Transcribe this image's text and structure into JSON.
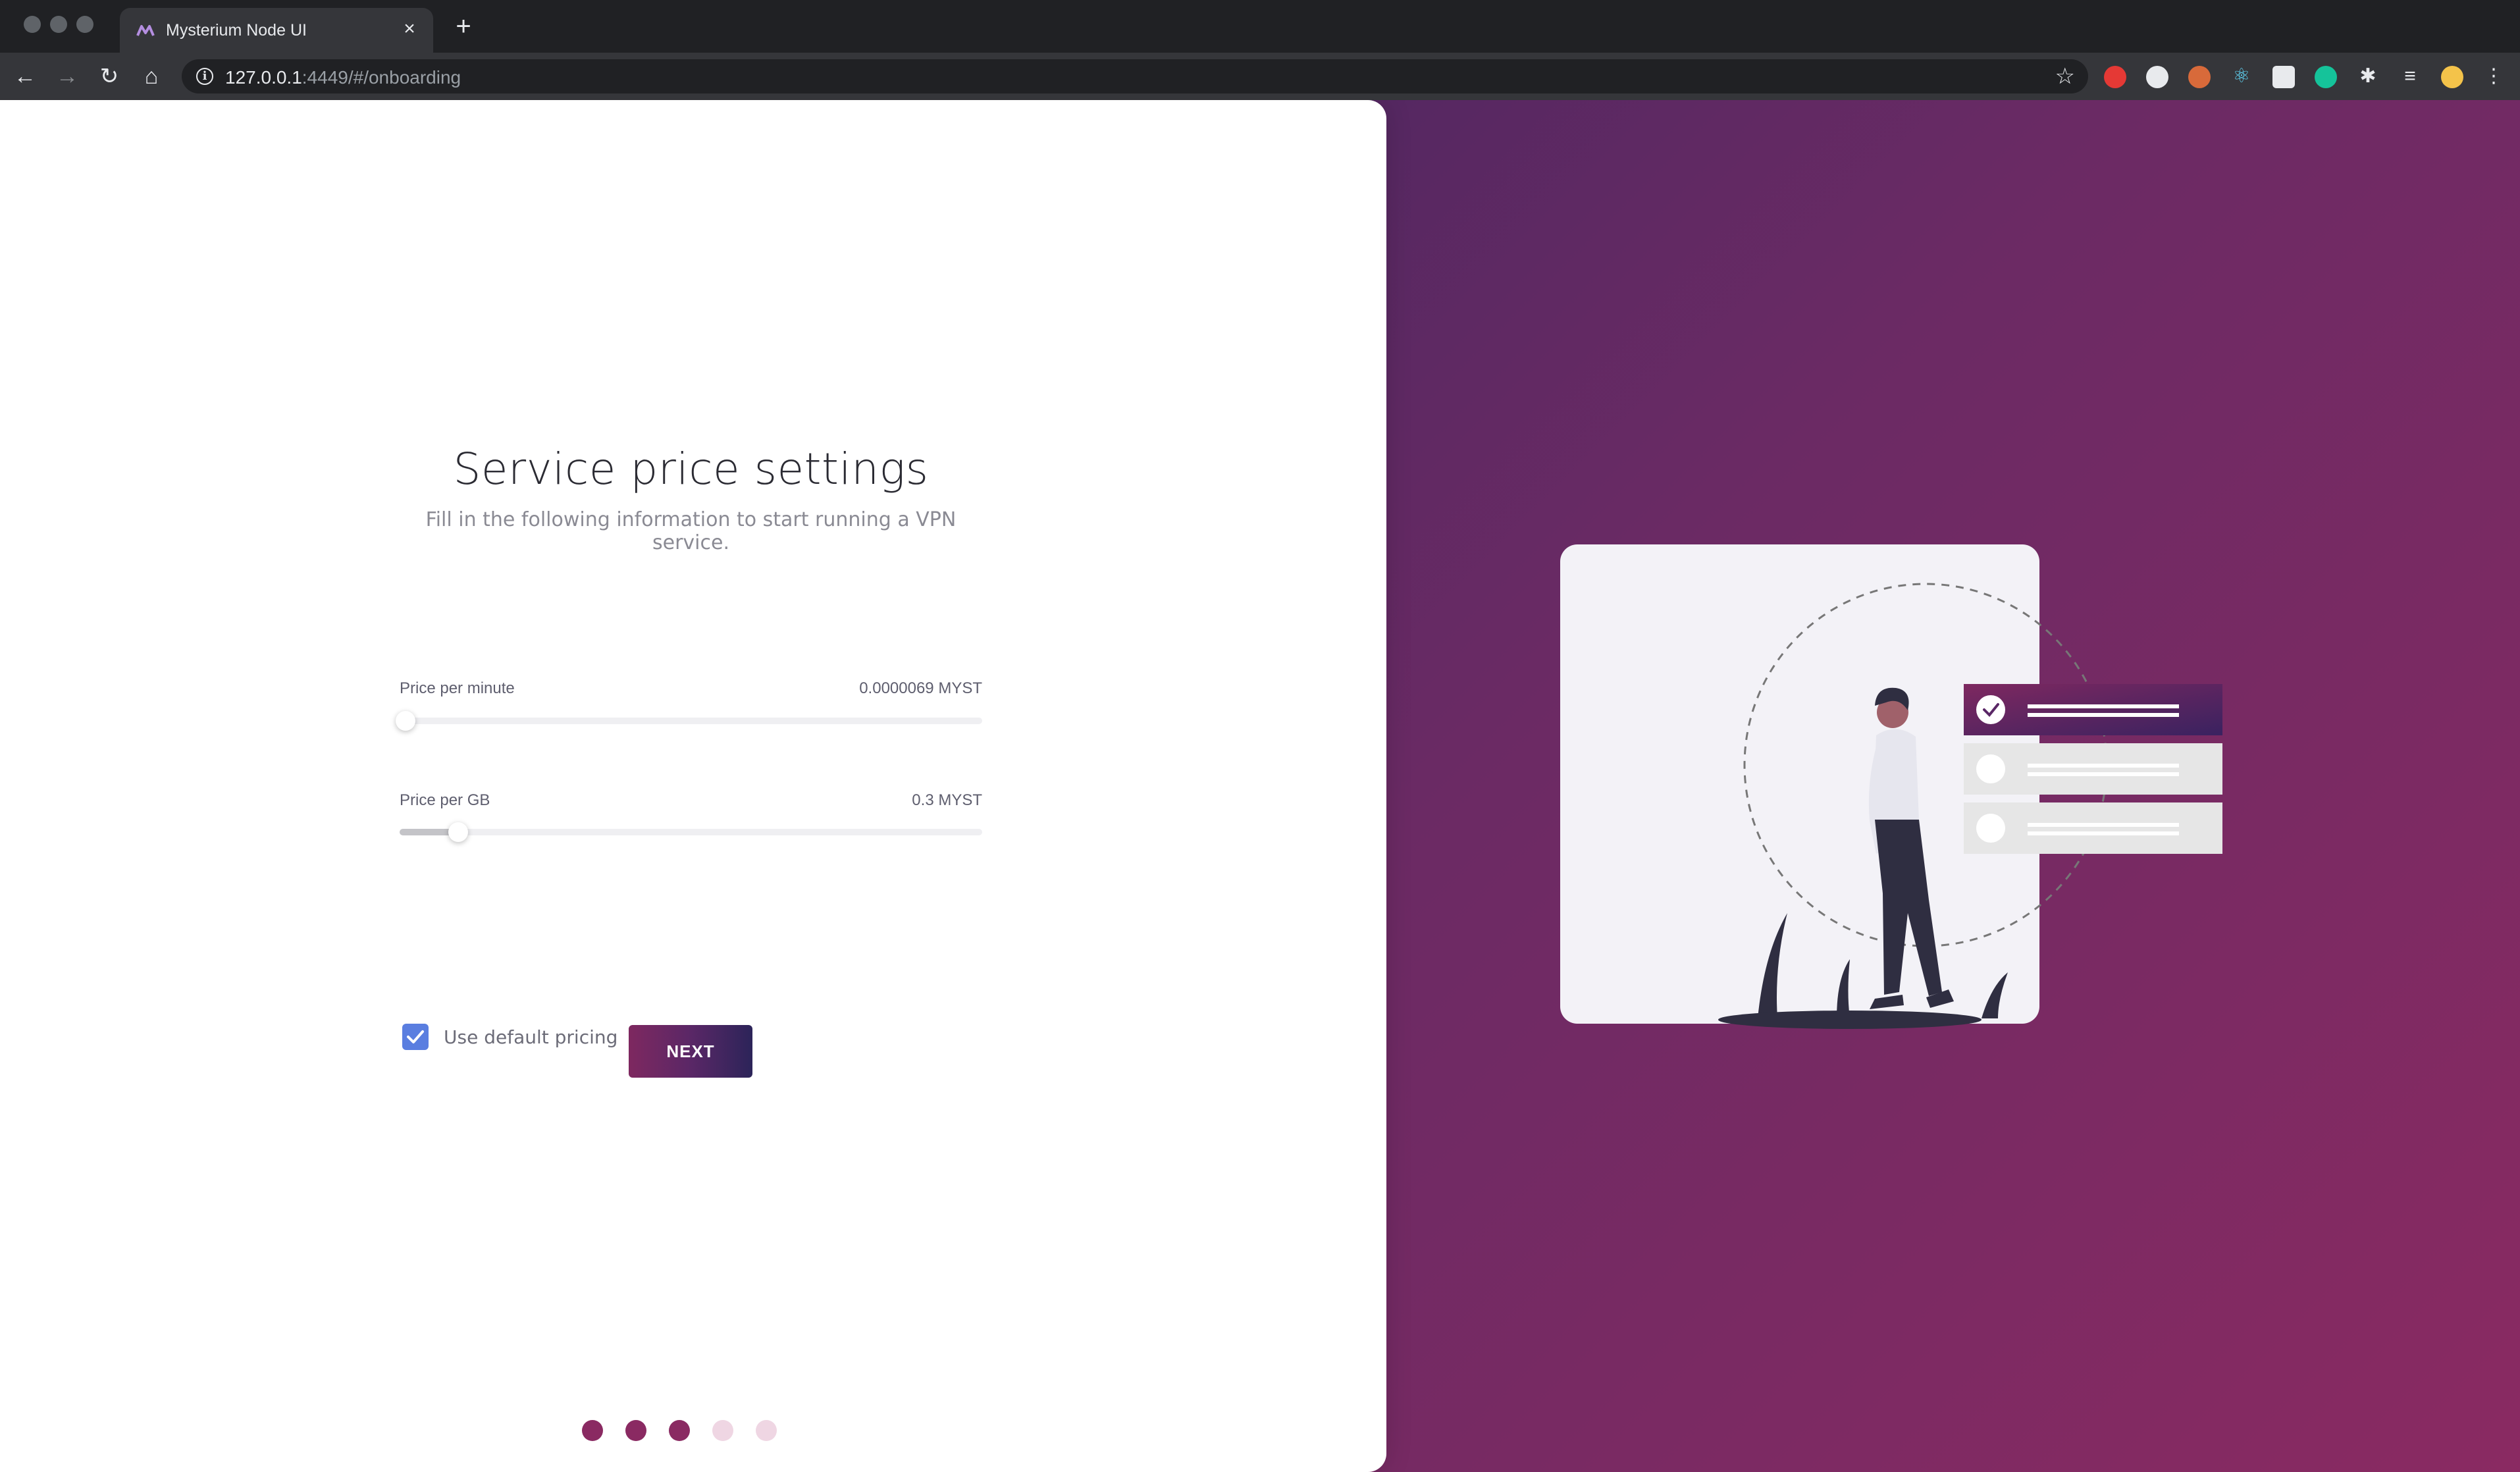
{
  "browser": {
    "tab_title": "Mysterium Node UI",
    "url_host": "127.0.0.1",
    "url_rest": ":4449/#/onboarding"
  },
  "page": {
    "title": "Service price settings",
    "subtitle": "Fill in the following information to start running a VPN service.",
    "price_per_minute": {
      "label": "Price per minute",
      "value": "0.0000069 MYST",
      "slider_fraction": 0.01
    },
    "price_per_gb": {
      "label": "Price per GB",
      "value": "0.3 MYST",
      "slider_fraction": 0.1
    },
    "default_pricing": {
      "label": "Use default pricing",
      "checked": true
    },
    "next_label": "NEXT",
    "steps": {
      "total": 5,
      "current": 3
    }
  },
  "colors": {
    "accent": "#7e2860",
    "accent_dark": "#2c2459",
    "checkbox": "#5a7ee0",
    "dot_active": "#8a2a62",
    "dot_inactive": "#efd6e3"
  }
}
